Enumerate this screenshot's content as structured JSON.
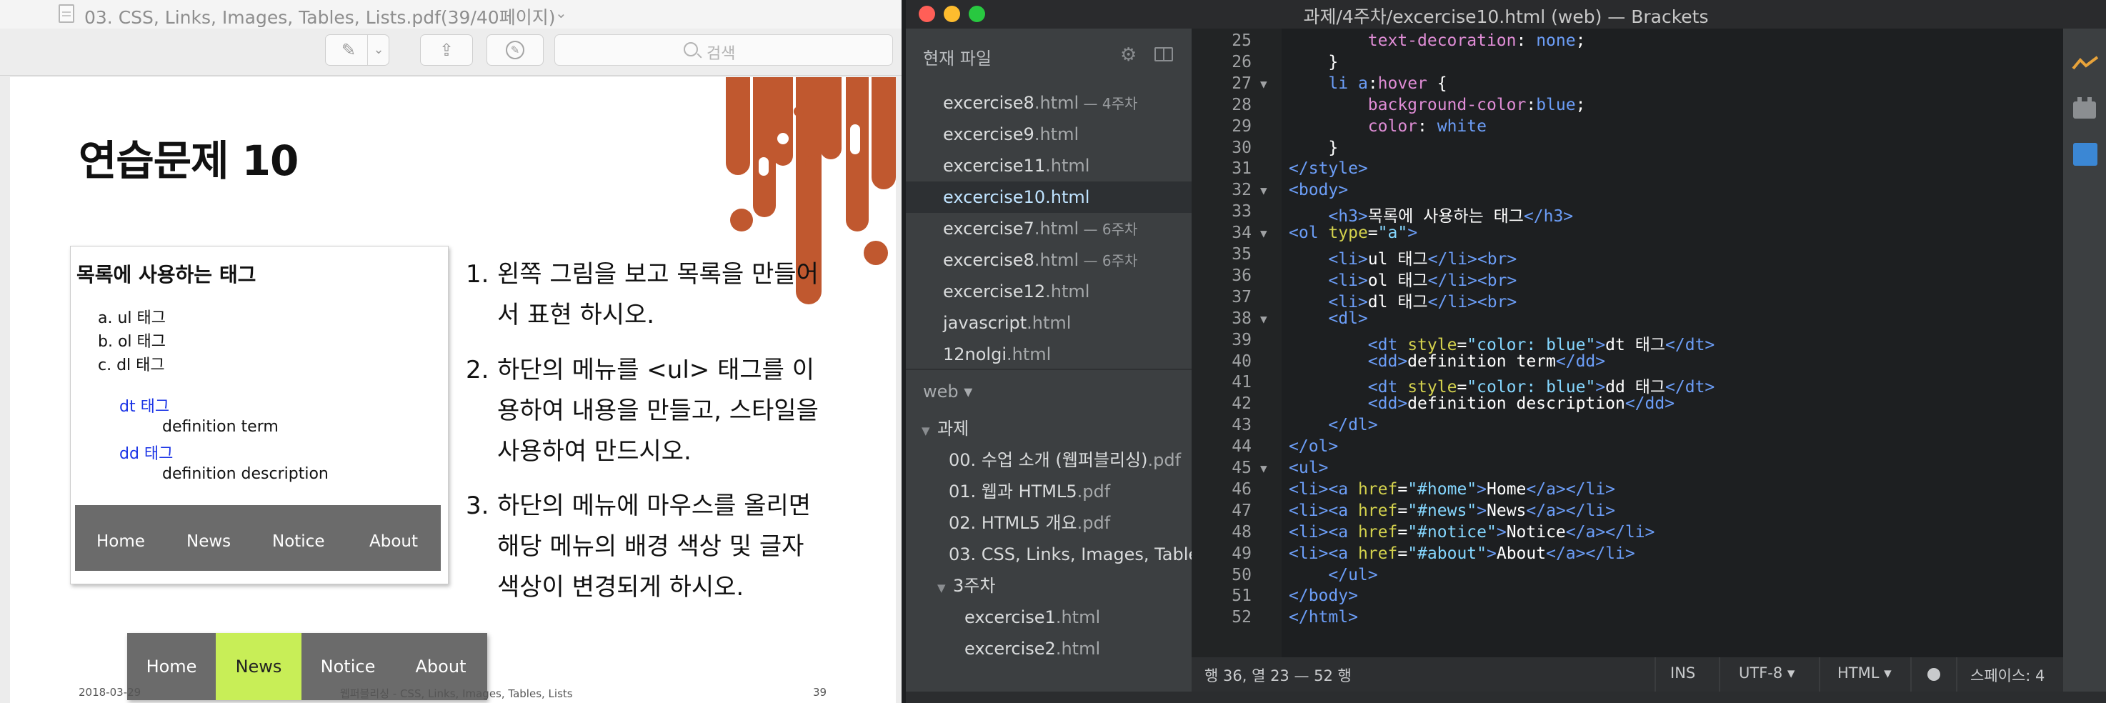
{
  "pdf_viewer": {
    "title": "03. CSS, Links, Images, Tables, Lists.pdf(39/40페이지)",
    "search_placeholder": "검색",
    "page": {
      "title": "연습문제 10",
      "sample": {
        "heading": "목록에 사용하는 태그",
        "ol_items": [
          "a. ul 태그",
          "b. ol 태그",
          "c. dl 태그"
        ],
        "dl_items": [
          {
            "dt": "dt 태그",
            "dd": "definition term"
          },
          {
            "dt": "dd 태그",
            "dd": "definition description"
          }
        ],
        "menu": [
          "Home",
          "News",
          "Notice",
          "About"
        ],
        "menu_hover": [
          "Home",
          "News",
          "Notice",
          "About"
        ],
        "menu_hover_active": "News"
      },
      "instructions": [
        {
          "num": "1.",
          "text": "왼쪽 그림을 보고 목록을 만들어서 표현 하시오."
        },
        {
          "num": "2.",
          "text": "하단의 메뉴를 <ul> 태그를 이용하여 내용을 만들고, 스타일을 사용하여 만드시오."
        },
        {
          "num": "3.",
          "text": "하단의 메뉴에 마우스를 올리면 해당 메뉴의 배경 색상 및 글자 색상이 변경되게 하시오."
        }
      ],
      "footer": {
        "date": "2018-03-29",
        "course": "웹퍼블리싱 - CSS, Links, Images, Tables, Lists",
        "page": "39"
      }
    },
    "colors": {
      "drip": "#c0582f",
      "menu_bg": "#6b6b6b",
      "menu_active": "#c8ee57",
      "dt_blue": "#1a33e6"
    }
  },
  "brackets": {
    "window_title": "과제/4주차/excercise10.html (web) — Brackets",
    "working_files_header": "현재 파일",
    "working_files": [
      {
        "name": "excercise8",
        "ext": ".html",
        "dir": " — 4주차",
        "selected": false
      },
      {
        "name": "excercise9",
        "ext": ".html",
        "dir": "",
        "selected": false
      },
      {
        "name": "excercise11",
        "ext": ".html",
        "dir": "",
        "selected": false
      },
      {
        "name": "excercise10",
        "ext": ".html",
        "dir": "",
        "selected": true
      },
      {
        "name": "excercise7",
        "ext": ".html",
        "dir": " — 6주차",
        "selected": false
      },
      {
        "name": "excercise8",
        "ext": ".html",
        "dir": " — 6주차",
        "selected": false
      },
      {
        "name": "excercise12",
        "ext": ".html",
        "dir": "",
        "selected": false
      },
      {
        "name": "javascript",
        "ext": ".html",
        "dir": "",
        "selected": false
      },
      {
        "name": "12nolgi",
        "ext": ".html",
        "dir": "",
        "selected": false
      }
    ],
    "project_name": "web ▾",
    "tree": [
      {
        "label": "과제",
        "ext": "",
        "depth": 0,
        "folder": true
      },
      {
        "label": "00. 수업 소개 (웹퍼블리싱)",
        "ext": ".pdf",
        "depth": 1,
        "folder": false
      },
      {
        "label": "01. 웹과 HTML5",
        "ext": ".pdf",
        "depth": 1,
        "folder": false
      },
      {
        "label": "02. HTML5 개요",
        "ext": ".pdf",
        "depth": 1,
        "folder": false
      },
      {
        "label": "03. CSS, Links, Images, Table",
        "ext": "",
        "depth": 1,
        "folder": false
      },
      {
        "label": "3주차",
        "ext": "",
        "depth": 1,
        "folder": true
      },
      {
        "label": "excercise1",
        "ext": ".html",
        "depth": 2,
        "folder": false
      },
      {
        "label": "excercise2",
        "ext": ".html",
        "depth": 2,
        "folder": false
      }
    ],
    "code_lines": [
      {
        "n": "25",
        "fold": "",
        "html": "        <span class=\"c-prop\">text-decoration</span>: <span class=\"c-kw\">none</span>;"
      },
      {
        "n": "26",
        "fold": "",
        "html": "    }"
      },
      {
        "n": "27",
        "fold": "▼",
        "html": "    <span class=\"c-tag\">li</span> <span class=\"c-tag\">a</span>:<span class=\"c-prop\">hover</span> {"
      },
      {
        "n": "28",
        "fold": "",
        "html": "        <span class=\"c-prop\">background-color</span>:<span class=\"c-kw\">blue</span>;"
      },
      {
        "n": "29",
        "fold": "",
        "html": "        <span class=\"c-prop\">color</span>: <span class=\"c-kw\">white</span>"
      },
      {
        "n": "30",
        "fold": "",
        "html": "    }"
      },
      {
        "n": "31",
        "fold": "",
        "html": "<span class=\"c-tag\">&lt;/style&gt;</span>"
      },
      {
        "n": "32",
        "fold": "▼",
        "html": "<span class=\"c-tag\">&lt;body&gt;</span>"
      },
      {
        "n": "33",
        "fold": "",
        "html": "    <span class=\"c-tag\">&lt;h3&gt;</span>목록에 사용하는 태그<span class=\"c-tag\">&lt;/h3&gt;</span>"
      },
      {
        "n": "34",
        "fold": "▼",
        "html": "<span class=\"c-tag\">&lt;ol</span> <span class=\"c-attr\">type</span>=<span class=\"c-str\">\"a\"</span><span class=\"c-tag\">&gt;</span>"
      },
      {
        "n": "35",
        "fold": "",
        "html": "    <span class=\"c-tag\">&lt;li&gt;</span>ul 태그<span class=\"c-tag\">&lt;/li&gt;&lt;br&gt;</span>"
      },
      {
        "n": "36",
        "fold": "",
        "html": "    <span class=\"c-tag\">&lt;li&gt;</span>ol 태그<span class=\"c-tag\">&lt;/li&gt;&lt;br&gt;</span>"
      },
      {
        "n": "37",
        "fold": "",
        "html": "    <span class=\"c-tag\">&lt;li&gt;</span>dl 태그<span class=\"c-tag\">&lt;/li&gt;&lt;br&gt;</span>"
      },
      {
        "n": "38",
        "fold": "▼",
        "html": "    <span class=\"c-tag\">&lt;dl&gt;</span>"
      },
      {
        "n": "39",
        "fold": "",
        "html": "        <span class=\"c-tag\">&lt;dt</span> <span class=\"c-attr\">style</span>=<span class=\"c-str\">\"color: blue\"</span><span class=\"c-tag\">&gt;</span>dt 태그<span class=\"c-tag\">&lt;/dt&gt;</span>"
      },
      {
        "n": "40",
        "fold": "",
        "html": "        <span class=\"c-tag\">&lt;dd&gt;</span>definition term<span class=\"c-tag\">&lt;/dd&gt;</span>"
      },
      {
        "n": "41",
        "fold": "",
        "html": "        <span class=\"c-tag\">&lt;dt</span> <span class=\"c-attr\">style</span>=<span class=\"c-str\">\"color: blue\"</span><span class=\"c-tag\">&gt;</span>dd 태그<span class=\"c-tag\">&lt;/dt&gt;</span>"
      },
      {
        "n": "42",
        "fold": "",
        "html": "        <span class=\"c-tag\">&lt;dd&gt;</span>definition description<span class=\"c-tag\">&lt;/dd&gt;</span>"
      },
      {
        "n": "43",
        "fold": "",
        "html": "    <span class=\"c-tag\">&lt;/dl&gt;</span>"
      },
      {
        "n": "44",
        "fold": "",
        "html": "<span class=\"c-tag\">&lt;/ol&gt;</span>"
      },
      {
        "n": "45",
        "fold": "▼",
        "html": "<span class=\"c-tag\">&lt;ul&gt;</span>"
      },
      {
        "n": "46",
        "fold": "",
        "html": "<span class=\"c-tag\">&lt;li&gt;&lt;a</span> <span class=\"c-attr\">href</span>=<span class=\"c-str\">\"#home\"</span><span class=\"c-tag\">&gt;</span>Home<span class=\"c-tag\">&lt;/a&gt;&lt;/li&gt;</span>"
      },
      {
        "n": "47",
        "fold": "",
        "html": "<span class=\"c-tag\">&lt;li&gt;&lt;a</span> <span class=\"c-attr\">href</span>=<span class=\"c-str\">\"#news\"</span><span class=\"c-tag\">&gt;</span>News<span class=\"c-tag\">&lt;/a&gt;&lt;/li&gt;</span>"
      },
      {
        "n": "48",
        "fold": "",
        "html": "<span class=\"c-tag\">&lt;li&gt;&lt;a</span> <span class=\"c-attr\">href</span>=<span class=\"c-str\">\"#notice\"</span><span class=\"c-tag\">&gt;</span>Notice<span class=\"c-tag\">&lt;/a&gt;&lt;/li&gt;</span>"
      },
      {
        "n": "49",
        "fold": "",
        "html": "<span class=\"c-tag\">&lt;li&gt;&lt;a</span> <span class=\"c-attr\">href</span>=<span class=\"c-str\">\"#about\"</span><span class=\"c-tag\">&gt;</span>About<span class=\"c-tag\">&lt;/a&gt;&lt;/li&gt;</span>"
      },
      {
        "n": "50",
        "fold": "",
        "html": "    <span class=\"c-tag\">&lt;/ul&gt;</span>"
      },
      {
        "n": "51",
        "fold": "",
        "html": "<span class=\"c-tag\">&lt;/body&gt;</span>"
      },
      {
        "n": "52",
        "fold": "",
        "html": "<span class=\"c-tag\">&lt;/html&gt;</span>"
      }
    ],
    "status": {
      "cursor": "행 36, 열 23 — 52 행",
      "mode": "INS",
      "encoding": "UTF-8 ▾",
      "language": "HTML ▾",
      "indent": "스페이스: 4"
    }
  }
}
